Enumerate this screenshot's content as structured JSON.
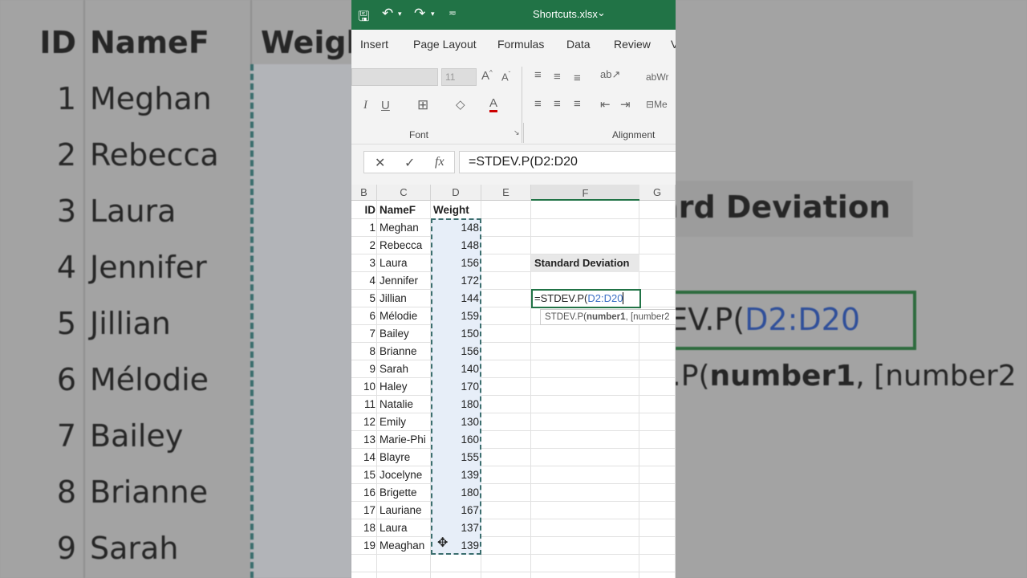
{
  "title_bar": {
    "file_name": "Shortcuts.xlsx",
    "chevron": "⌄",
    "icons": [
      "save-icon",
      "undo-icon",
      "redo-icon",
      "customize-qat-icon"
    ]
  },
  "tabs": [
    "Insert",
    "Page Layout",
    "Formulas",
    "Data",
    "Review",
    "V"
  ],
  "ribbon": {
    "font_size": "11",
    "font_group": "Font",
    "alignment_group": "Alignment",
    "wrap_label": "Wr",
    "merge_label": "Me"
  },
  "formula_bar": {
    "cancel": "✕",
    "enter": "✓",
    "fx": "fx",
    "value": "=STDEV.P(D2:D20"
  },
  "columns": [
    "B",
    "C",
    "D",
    "E",
    "F",
    "G"
  ],
  "headers": {
    "id": "ID",
    "name": "NameF",
    "weight": "Weight"
  },
  "rows": [
    {
      "id": "1",
      "name": "Meghan",
      "weight": "148"
    },
    {
      "id": "2",
      "name": "Rebecca",
      "weight": "148"
    },
    {
      "id": "3",
      "name": "Laura",
      "weight": "156"
    },
    {
      "id": "4",
      "name": "Jennifer",
      "weight": "172"
    },
    {
      "id": "5",
      "name": "Jillian",
      "weight": "144"
    },
    {
      "id": "6",
      "name": "Mélodie",
      "weight": "159"
    },
    {
      "id": "7",
      "name": "Bailey",
      "weight": "150"
    },
    {
      "id": "8",
      "name": "Brianne",
      "weight": "156"
    },
    {
      "id": "9",
      "name": "Sarah",
      "weight": "140"
    },
    {
      "id": "10",
      "name": "Haley",
      "weight": "170"
    },
    {
      "id": "11",
      "name": "Natalie",
      "weight": "180"
    },
    {
      "id": "12",
      "name": "Emily",
      "weight": "130"
    },
    {
      "id": "13",
      "name": "Marie-Phi",
      "weight": "160"
    },
    {
      "id": "14",
      "name": "Blayre",
      "weight": "155"
    },
    {
      "id": "15",
      "name": "Jocelyne",
      "weight": "139"
    },
    {
      "id": "16",
      "name": "Brigette",
      "weight": "180"
    },
    {
      "id": "17",
      "name": "Lauriane",
      "weight": "167"
    },
    {
      "id": "18",
      "name": "Laura",
      "weight": "137"
    },
    {
      "id": "19",
      "name": "Meaghan",
      "weight": "139"
    }
  ],
  "label_cell": "Standard Deviation",
  "edit_cell": {
    "prefix": "=STDEV.P(",
    "range": "D2:D20"
  },
  "tooltip": {
    "func": "STDEV.P(",
    "arg1": "number1",
    "rest": ", [number2"
  },
  "colors": {
    "excel_green": "#217346",
    "range_blue": "#3a6fc4",
    "selection_fill": "#e7eef8"
  }
}
